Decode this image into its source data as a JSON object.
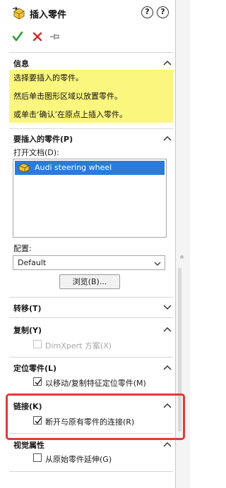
{
  "header": {
    "title": "插入零件",
    "help_glyph": "?",
    "colors": {
      "ok": "#2e9e2e",
      "cancel": "#d22a2a",
      "highlight": "#e03a3a",
      "info_bg": "#fbf67d",
      "selection": "#2b7bd8"
    }
  },
  "sections": {
    "info": {
      "title": "信息",
      "lines": [
        "选择要插入的零件。",
        "然后单击图形区域以放置零件。",
        "或单击‘确认’在原点上插入零件。"
      ]
    },
    "part_to_insert": {
      "title": "要插入的零件(P)",
      "open_docs_label": "打开文档(D):",
      "documents": [
        "Audi steering wheel"
      ],
      "config_label": "配置:",
      "config_value": "Default",
      "browse_label": "浏览(B)..."
    },
    "transfer": {
      "title": "转移(T)"
    },
    "copy": {
      "title": "复制(Y)",
      "dimxpert_label": "DimXpert 方案(X)",
      "dimxpert_checked": false,
      "dimxpert_enabled": false
    },
    "locate": {
      "title": "定位零件(L)",
      "move_label": "以移动/复制特征定位零件(M)",
      "move_checked": true
    },
    "link": {
      "title": "链接(K)",
      "break_label": "断开与原有零件的连接(R)",
      "break_checked": true
    },
    "display": {
      "title": "视觉属性",
      "propagate_label": "从原始零件延伸(G)",
      "propagate_checked": false
    }
  }
}
